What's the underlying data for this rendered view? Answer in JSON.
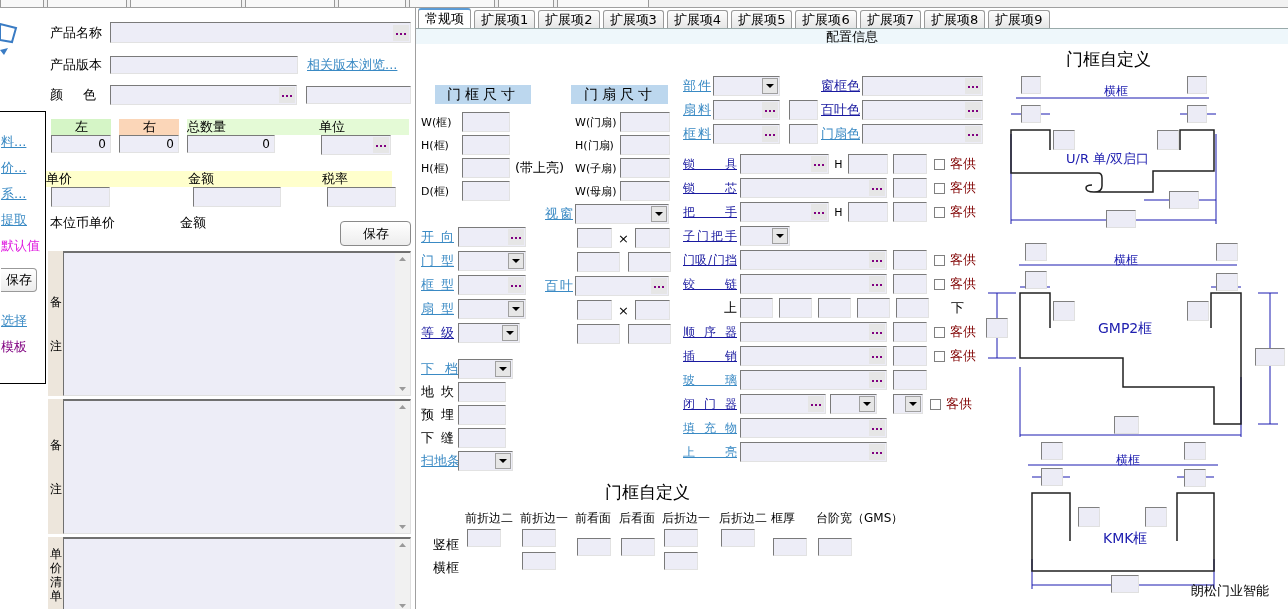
{
  "sidebar": {
    "items": [
      {
        "kind": "link",
        "text": "料...",
        "color": "#3a8ac4"
      },
      {
        "kind": "link",
        "text": "价...",
        "color": "#3a8ac4"
      },
      {
        "kind": "link",
        "text": "系...",
        "color": "#3a8ac4"
      },
      {
        "kind": "link",
        "text": "提取",
        "color": "#3a8ac4"
      },
      {
        "kind": "text",
        "text": "默认值",
        "color": "#e020e0"
      },
      {
        "kind": "button",
        "text": "保存"
      },
      {
        "kind": "link",
        "text": "选择",
        "color": "#3a8ac4"
      },
      {
        "kind": "text",
        "text": "模板",
        "color": "#800080"
      }
    ]
  },
  "product": {
    "name_label": "产品名称",
    "version_label": "产品版本",
    "version_link": "相关版本浏览...",
    "color_label": "颜 色"
  },
  "quantity": [
    {
      "kind": "count",
      "label": "左",
      "color": "#d5f5c6",
      "value": "0"
    },
    {
      "kind": "count",
      "label": "右",
      "color": "#fbd6b8",
      "value": "0"
    },
    {
      "kind": "total",
      "label": "总数量",
      "color": "#e4fad6",
      "value": "0"
    },
    {
      "kind": "unit",
      "label": "单位",
      "color": "#e4fad6"
    }
  ],
  "price": [
    "单价",
    "金额",
    "税率"
  ],
  "base": [
    "本位币单价",
    "金额"
  ],
  "save_button": "保存",
  "notes": [
    {
      "kind": "spread",
      "label": "备注"
    },
    {
      "kind": "spread",
      "label": "备注"
    },
    {
      "kind": "stacked",
      "label": "单价清单"
    }
  ],
  "config": {
    "tabs": [
      {
        "label": "常规项",
        "selected": true
      },
      {
        "label": "扩展项1",
        "selected": false
      },
      {
        "label": "扩展项2",
        "selected": false
      },
      {
        "label": "扩展项3",
        "selected": false
      },
      {
        "label": "扩展项4",
        "selected": false
      },
      {
        "label": "扩展项5",
        "selected": false
      },
      {
        "label": "扩展项6",
        "selected": false
      },
      {
        "label": "扩展项7",
        "selected": false
      },
      {
        "label": "扩展项8",
        "selected": false
      },
      {
        "label": "扩展项9",
        "selected": false
      }
    ],
    "header": "配置信息",
    "frame_size": {
      "title": "门框尺寸",
      "fields": [
        {
          "label": "W(框)"
        },
        {
          "label": "H(框)"
        },
        {
          "label": "H(框)",
          "note": "(带上亮)"
        },
        {
          "label": "D(框)"
        }
      ]
    },
    "leaf_size": {
      "title": "门扇尺寸",
      "fields": [
        "W(门扇)",
        "H(门扇)",
        "W(子扇)",
        "W(母扇)"
      ]
    },
    "frame_options": [
      {
        "kind": "popup",
        "label": "开 向",
        "color": "#3a8ac4"
      },
      {
        "kind": "dropdown",
        "label": "门 型",
        "color": "#3a8ac4"
      },
      {
        "kind": "popup",
        "label": "框 型",
        "color": "#3a8ac4"
      },
      {
        "kind": "dropdown",
        "label": "扇 型",
        "color": "#3a8ac4"
      },
      {
        "kind": "dropdown",
        "label": "等 级",
        "color": "#1a1aa0"
      }
    ],
    "sill_options": [
      {
        "kind": "dropdown",
        "label": "下 档",
        "color": "#3a8ac4"
      },
      {
        "kind": "field",
        "label": "地 坎"
      },
      {
        "kind": "field",
        "label": "预 埋"
      },
      {
        "kind": "field",
        "label": "下 缝"
      },
      {
        "kind": "dropdown",
        "label": "扫地条",
        "color": "#3a8ac4"
      }
    ],
    "leaf_options": [
      {
        "kind": "dropdown",
        "label": "视窗",
        "color": "#3a8ac4"
      },
      {
        "kind": "pair",
        "sep": "×"
      },
      {
        "kind": "pair"
      },
      {
        "kind": "popup",
        "label": "百叶",
        "color": "#3a8ac4"
      },
      {
        "kind": "pair",
        "sep": "×"
      },
      {
        "kind": "pair"
      }
    ],
    "materials": [
      {
        "kind": "dropdown",
        "label": "部件",
        "color": "#3a8ac4",
        "pair": {
          "label": "窗框色",
          "color": "#1a1aa0"
        }
      },
      {
        "kind": "popup",
        "label": "扇料",
        "color": "#3a8ac4",
        "pair": {
          "label": "百叶色",
          "color": "#1a1aa0"
        }
      },
      {
        "kind": "popup",
        "label": "框料",
        "color": "#3a8ac4",
        "pair": {
          "label": "门扇色",
          "color": "#3a8ac4"
        }
      }
    ],
    "hardware": [
      {
        "kind": "popup_h",
        "label": "锁 具",
        "color": "#1a1aa0",
        "h_label": "H",
        "supplied": {
          "label": "客供",
          "checked": false
        }
      },
      {
        "kind": "popup_field",
        "label": "锁 芯",
        "color": "#1a1aa0",
        "supplied": {
          "label": "客供",
          "checked": false
        }
      },
      {
        "kind": "popup_h",
        "label": "把 手",
        "color": "#1a1aa0",
        "h_label": "H",
        "supplied": {
          "label": "客供",
          "checked": false
        }
      },
      {
        "kind": "dropdown",
        "label": "子门把手",
        "color": "#1a1aa0"
      },
      {
        "kind": "popup_field",
        "label": "门吸/门挡",
        "color": "#1a1aa0",
        "supplied": {
          "label": "客供",
          "checked": false
        }
      },
      {
        "kind": "popup_field",
        "label": "铰 链",
        "color": "#1a1aa0",
        "supplied": {
          "label": "客供",
          "checked": false
        }
      },
      {
        "kind": "levels",
        "label": "上",
        "end_label": "下"
      },
      {
        "kind": "popup_field",
        "label": "顺 序 器",
        "color": "#1a1aa0",
        "supplied": {
          "label": "客供",
          "checked": false
        }
      },
      {
        "kind": "popup_field",
        "label": "插 销",
        "color": "#1a1aa0",
        "supplied": {
          "label": "客供",
          "checked": false
        }
      },
      {
        "kind": "popup_field",
        "label": "玻 璃",
        "color": "#3a8ac4"
      },
      {
        "kind": "closer",
        "label": "闭 门 器",
        "color": "#1a1aa0",
        "supplied": {
          "label": "客供",
          "checked": false
        }
      },
      {
        "kind": "popup",
        "label": "填 充 物",
        "color": "#3a8ac4"
      },
      {
        "kind": "popup",
        "label": "上 亮",
        "color": "#3a8ac4"
      }
    ],
    "custom": {
      "title": "门框自定义",
      "row_labels": [
        "竖框",
        "横框"
      ],
      "columns": [
        {
          "label": "前折边二",
          "kind": "upper"
        },
        {
          "label": "前折边一",
          "kind": "both"
        },
        {
          "label": "前看面",
          "kind": "middle"
        },
        {
          "label": "后看面",
          "kind": "middle"
        },
        {
          "label": "后折边一",
          "kind": "both"
        },
        {
          "label": "后折边二",
          "kind": "upper"
        },
        {
          "label": "框厚",
          "kind": "middle"
        },
        {
          "label": "台阶宽（GMS）",
          "kind": "middle"
        }
      ]
    },
    "diagram": {
      "title": "门框自定义",
      "profiles": [
        {
          "kind": "ur",
          "top_label": "横框",
          "caption": "U/R 单/双启口"
        },
        {
          "kind": "gmp2",
          "top_label": "横框",
          "caption": "GMP2框"
        },
        {
          "kind": "kmk",
          "top_label": "横框",
          "caption": "KMK框"
        }
      ],
      "footer": "朗松门业智能"
    }
  }
}
